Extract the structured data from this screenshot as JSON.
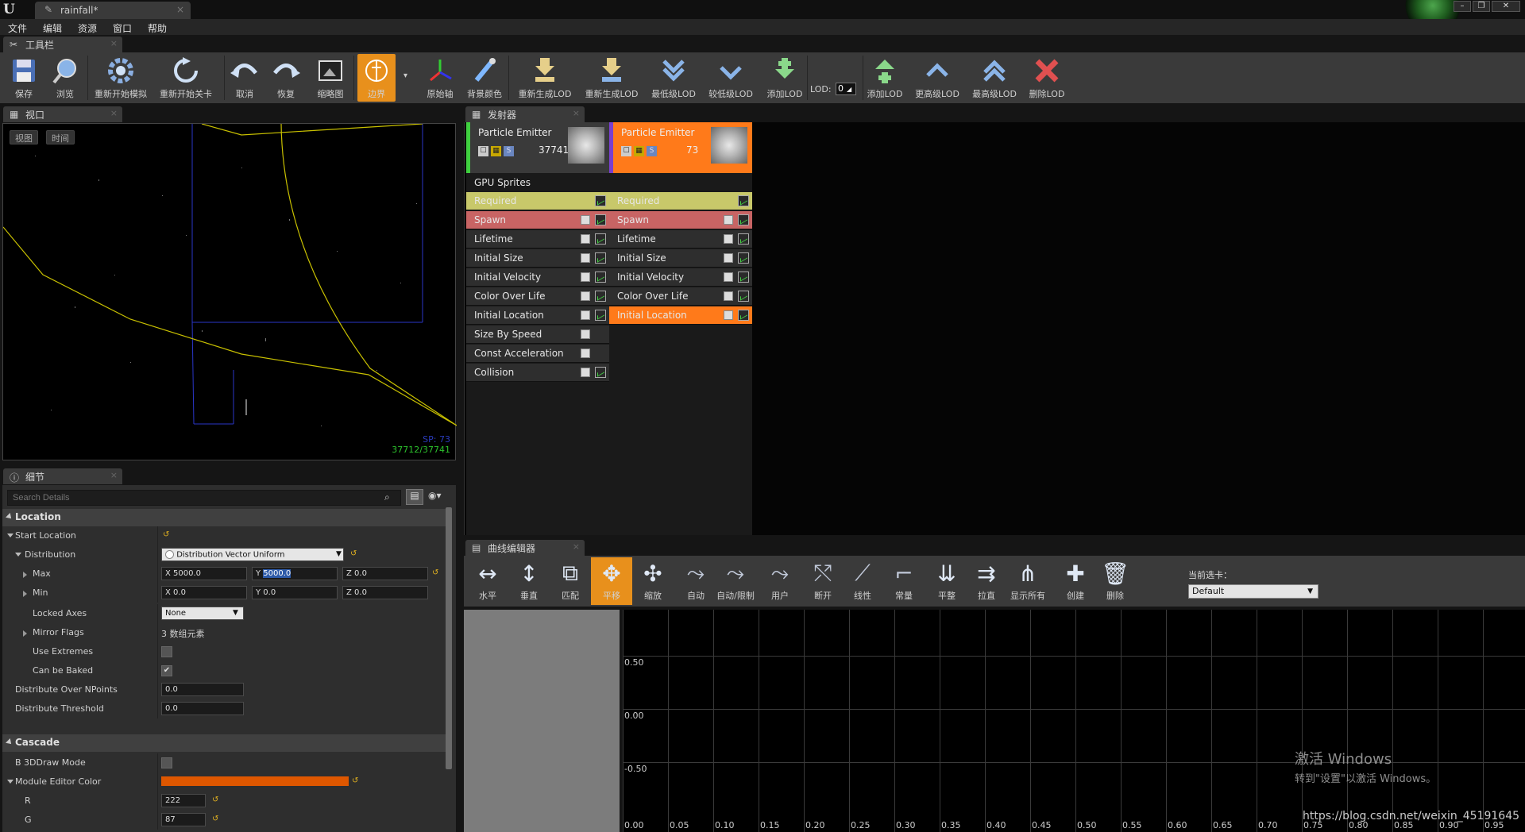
{
  "window": {
    "doc_tab": "rainfall*",
    "logo": "U"
  },
  "menu": [
    "文件",
    "编辑",
    "资源",
    "窗口",
    "帮助"
  ],
  "toolbar_tab": "工具栏",
  "toolbar": [
    {
      "label": "保存",
      "icon": "save-icon"
    },
    {
      "label": "浏览",
      "icon": "browse-icon"
    },
    {
      "label": "重新开始模拟",
      "icon": "restart-sim-icon"
    },
    {
      "label": "重新开始关卡",
      "icon": "restart-level-icon"
    },
    {
      "label": "取消",
      "icon": "undo-icon"
    },
    {
      "label": "恢复",
      "icon": "redo-icon"
    },
    {
      "label": "缩略图",
      "icon": "thumbnail-icon"
    },
    {
      "label": "边界",
      "icon": "bounds-icon"
    },
    {
      "label": "原始轴",
      "icon": "origin-axis-icon"
    },
    {
      "label": "背景颜色",
      "icon": "background-color-icon"
    },
    {
      "label": "重新生成LOD",
      "icon": "regen-lod-icon"
    },
    {
      "label": "重新生成LOD",
      "icon": "regen-lod2-icon"
    },
    {
      "label": "最低级LOD",
      "icon": "lowest-lod-icon"
    },
    {
      "label": "较低级LOD",
      "icon": "lower-lod-icon"
    },
    {
      "label": "添加LOD",
      "icon": "add-lod-icon"
    },
    {
      "label": "添加LOD",
      "icon": "add-lod2-icon"
    },
    {
      "label": "更高级LOD",
      "icon": "higher-lod-icon"
    },
    {
      "label": "最高级LOD",
      "icon": "highest-lod-icon"
    },
    {
      "label": "删除LOD",
      "icon": "delete-lod-icon"
    }
  ],
  "lod": {
    "label": "LOD:",
    "value": "0"
  },
  "viewport": {
    "tab": "视口",
    "btn_view": "视图",
    "btn_time": "时间",
    "stat1": "SP: 73",
    "stat2": "37712/37741"
  },
  "details": {
    "tab": "细节",
    "search_placeholder": "Search Details",
    "sec_location": "Location",
    "start_location": "Start Location",
    "distribution": "Distribution",
    "distribution_value": "Distribution Vector Uniform",
    "max": "Max",
    "max_x": "5000.0",
    "max_y": "5000.0",
    "max_z": "0.0",
    "min": "Min",
    "min_x": "0.0",
    "min_y": "0.0",
    "min_z": "0.0",
    "locked_axes": "Locked Axes",
    "locked_axes_value": "None",
    "mirror_flags": "Mirror Flags",
    "mirror_flags_value": "3 数组元素",
    "use_extremes": "Use Extremes",
    "can_be_baked": "Can be Baked",
    "distribute_npoints": "Distribute Over NPoints",
    "distribute_npoints_value": "0.0",
    "distribute_threshold": "Distribute Threshold",
    "distribute_threshold_value": "0.0",
    "sec_cascade": "Cascade",
    "b3d": "B 3DDraw Mode",
    "module_color": "Module Editor Color",
    "module_color_hex": "#de5700",
    "r": "R",
    "r_value": "222",
    "g": "G",
    "g_value": "87",
    "x": "X",
    "y": "Y",
    "z": "Z"
  },
  "emitters_tab": "发射器",
  "emitters": [
    {
      "title": "Particle Emitter",
      "count": "37741",
      "type": "GPU Sprites",
      "modules": [
        "Required",
        "Spawn",
        "Lifetime",
        "Initial Size",
        "Initial Velocity",
        "Color Over Life",
        "Initial Location",
        "Size By Speed",
        "Const Acceleration",
        "Collision"
      ]
    },
    {
      "title": "Particle Emitter",
      "count": "73",
      "type": "",
      "modules": [
        "Required",
        "Spawn",
        "Lifetime",
        "Initial Size",
        "Initial Velocity",
        "Color Over Life",
        "Initial Location"
      ]
    }
  ],
  "curve_editor": {
    "tab": "曲线编辑器",
    "tools": [
      "水平",
      "垂直",
      "匹配",
      "平移",
      "缩放",
      "自动",
      "自动/限制",
      "用户",
      "断开",
      "线性",
      "常量",
      "平整",
      "拉直",
      "显示所有",
      "创建",
      "删除"
    ],
    "current_tab_label": "当前选卡：",
    "current_tab_value": "Default",
    "y_labels": [
      "0.50",
      "0.00",
      "-0.50"
    ],
    "x_labels": [
      "0.00",
      "0.05",
      "0.10",
      "0.15",
      "0.20",
      "0.25",
      "0.30",
      "0.35",
      "0.40",
      "0.45",
      "0.50",
      "0.55",
      "0.60",
      "0.65",
      "0.70",
      "0.75",
      "0.80",
      "0.85",
      "0.90",
      "0.95"
    ]
  },
  "watermark": {
    "line1": "激活 Windows",
    "line2": "转到\"设置\"以激活 Windows。",
    "url": "https://blog.csdn.net/weixin_45191645"
  },
  "colors": {
    "accent": "#e8901c",
    "required": "#c8c86a",
    "spawn": "#c86464",
    "selected": "#ff7a1a",
    "emitter1_bar": "#3fcf3f",
    "emitter2_bar": "#7a3fcf"
  }
}
